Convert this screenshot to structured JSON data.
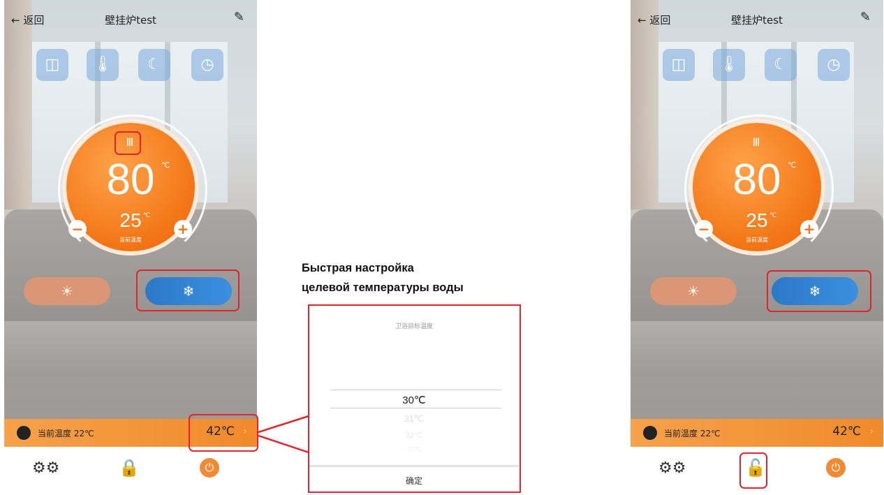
{
  "screens": [
    {
      "id": "left",
      "header": {
        "back_label": "← 返回",
        "title": "壁挂炉test",
        "edit_icon": "edit-icon"
      },
      "modes": [
        {
          "icon": "briefcase-icon",
          "glyph": "◫"
        },
        {
          "icon": "thermometer-icon",
          "glyph": "🌡"
        },
        {
          "icon": "moon-icon",
          "glyph": "☾"
        },
        {
          "icon": "clock-icon",
          "glyph": "◷"
        }
      ],
      "dial": {
        "radiator_icon": "Ⅲ",
        "target_temp": "80",
        "target_unit": "℃",
        "current_temp": "25",
        "current_unit": "℃",
        "current_label": "当前温度"
      },
      "buttons": {
        "minus": "−",
        "plus": "+",
        "sun": "☀",
        "snow": "❄"
      },
      "status": {
        "label": "当前温度 22℃",
        "target": "42℃",
        "arrow": "›"
      },
      "bottom": {
        "settings": "⚙⚙",
        "lock": "🔒",
        "power": "⏻"
      }
    },
    {
      "id": "right",
      "header": {
        "back_label": "← 返回",
        "title": "壁挂炉test",
        "edit_icon": "edit-icon"
      },
      "modes": [
        {
          "icon": "briefcase-icon",
          "glyph": "◫"
        },
        {
          "icon": "thermometer-icon",
          "glyph": "🌡"
        },
        {
          "icon": "moon-icon",
          "glyph": "☾"
        },
        {
          "icon": "clock-icon",
          "glyph": "◷"
        }
      ],
      "dial": {
        "radiator_icon": "Ⅲ",
        "target_temp": "80",
        "target_unit": "℃",
        "current_temp": "25",
        "current_unit": "℃",
        "current_label": "当前温度"
      },
      "buttons": {
        "minus": "−",
        "plus": "+",
        "sun": "☀",
        "snow": "❄"
      },
      "status": {
        "label": "当前温度 22℃",
        "target": "42℃",
        "arrow": "›"
      },
      "bottom": {
        "settings": "⚙⚙",
        "lock": "🔓",
        "power": "⏻"
      }
    }
  ],
  "caption": {
    "line1": "Быстрая настройка",
    "line2": "целевой температуры воды"
  },
  "popup": {
    "title": "卫浴目标温度",
    "options": [
      "30℃",
      "31℃",
      "32℃",
      "33℃"
    ],
    "selected": "30℃",
    "confirm": "确定"
  },
  "colors": {
    "accent_orange": "#f37616",
    "highlight_red": "#e0232d",
    "snow_blue": "#2b79c8"
  }
}
